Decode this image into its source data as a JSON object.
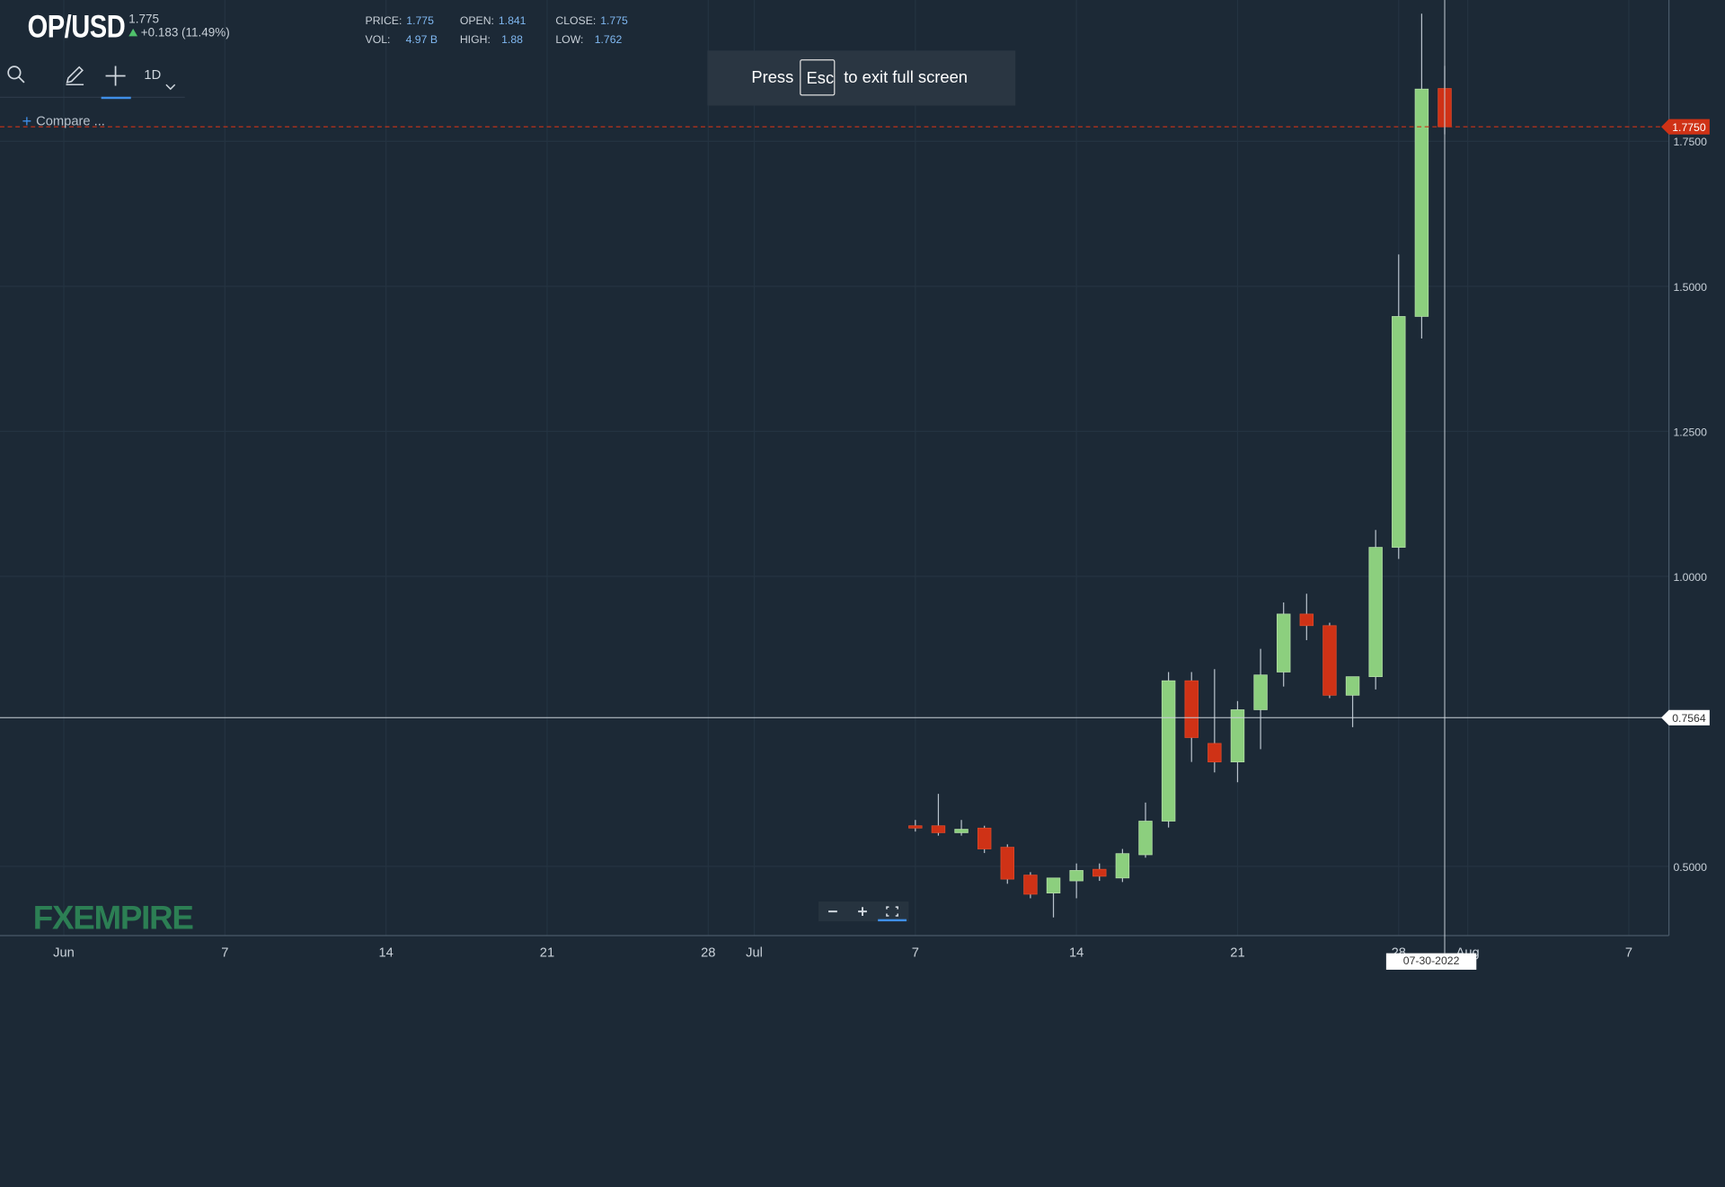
{
  "header": {
    "symbol": "OP/USD",
    "last_price": "1.775",
    "change": "+0.183 (11.49%)",
    "stats": {
      "price_label": "PRICE:",
      "price": "1.775",
      "open_label": "OPEN:",
      "open": "1.841",
      "close_label": "CLOSE:",
      "close": "1.775",
      "vol_label": "VOL:",
      "vol": "4.97 B",
      "high_label": "HIGH:",
      "high": "1.88",
      "low_label": "LOW:",
      "low": "1.762"
    }
  },
  "toolbar": {
    "interval": "1D",
    "compare_label": "Compare ..."
  },
  "fullscreen_notice": {
    "press": "Press",
    "key": "Esc",
    "rest": "to exit full screen"
  },
  "crosshair": {
    "date": "07-30-2022",
    "price": "0.7564"
  },
  "logo": "FXEMPIRE",
  "colors": {
    "background": "#1c2936",
    "up": "#8ccf7e",
    "down": "#cf3216",
    "last_price_line": "#cf3216"
  },
  "chart_data": {
    "type": "candlestick",
    "x_tick_labels": [
      "Jun",
      "7",
      "14",
      "21",
      "28",
      "Jul",
      "7",
      "14",
      "21",
      "28",
      "Aug",
      "7"
    ],
    "y_tick_labels": [
      "0.5000",
      "1.0000",
      "1.2500",
      "1.5000",
      "1.7500"
    ],
    "last_price_label": "1.7750",
    "ylim": [
      0.38,
      1.99
    ],
    "grid": true,
    "candles": [
      {
        "date": "07-07-2022",
        "open": 0.57,
        "high": 0.58,
        "low": 0.56,
        "close": 0.566
      },
      {
        "date": "07-08-2022",
        "open": 0.57,
        "high": 0.625,
        "low": 0.553,
        "close": 0.558
      },
      {
        "date": "07-09-2022",
        "open": 0.558,
        "high": 0.58,
        "low": 0.553,
        "close": 0.564
      },
      {
        "date": "07-10-2022",
        "open": 0.566,
        "high": 0.57,
        "low": 0.523,
        "close": 0.53
      },
      {
        "date": "07-11-2022",
        "open": 0.533,
        "high": 0.538,
        "low": 0.47,
        "close": 0.478
      },
      {
        "date": "07-12-2022",
        "open": 0.485,
        "high": 0.49,
        "low": 0.445,
        "close": 0.452
      },
      {
        "date": "07-13-2022",
        "open": 0.454,
        "high": 0.478,
        "low": 0.412,
        "close": 0.48
      },
      {
        "date": "07-14-2022",
        "open": 0.475,
        "high": 0.505,
        "low": 0.445,
        "close": 0.493
      },
      {
        "date": "07-15-2022",
        "open": 0.495,
        "high": 0.505,
        "low": 0.475,
        "close": 0.483
      },
      {
        "date": "07-16-2022",
        "open": 0.48,
        "high": 0.53,
        "low": 0.473,
        "close": 0.522
      },
      {
        "date": "07-17-2022",
        "open": 0.52,
        "high": 0.61,
        "low": 0.515,
        "close": 0.578
      },
      {
        "date": "07-18-2022",
        "open": 0.578,
        "high": 0.835,
        "low": 0.567,
        "close": 0.82
      },
      {
        "date": "07-19-2022",
        "open": 0.82,
        "high": 0.835,
        "low": 0.68,
        "close": 0.722
      },
      {
        "date": "07-20-2022",
        "open": 0.712,
        "high": 0.84,
        "low": 0.662,
        "close": 0.68
      },
      {
        "date": "07-21-2022",
        "open": 0.68,
        "high": 0.785,
        "low": 0.645,
        "close": 0.77
      },
      {
        "date": "07-22-2022",
        "open": 0.77,
        "high": 0.875,
        "low": 0.702,
        "close": 0.83
      },
      {
        "date": "07-23-2022",
        "open": 0.835,
        "high": 0.955,
        "low": 0.81,
        "close": 0.935
      },
      {
        "date": "07-24-2022",
        "open": 0.935,
        "high": 0.97,
        "low": 0.89,
        "close": 0.915
      },
      {
        "date": "07-25-2022",
        "open": 0.915,
        "high": 0.92,
        "low": 0.79,
        "close": 0.795
      },
      {
        "date": "07-26-2022",
        "open": 0.795,
        "high": 0.825,
        "low": 0.74,
        "close": 0.827
      },
      {
        "date": "07-27-2022",
        "open": 0.827,
        "high": 1.08,
        "low": 0.805,
        "close": 1.05
      },
      {
        "date": "07-28-2022",
        "open": 1.05,
        "high": 1.555,
        "low": 1.03,
        "close": 1.448
      },
      {
        "date": "07-29-2022",
        "open": 1.448,
        "high": 1.97,
        "low": 1.41,
        "close": 1.84
      },
      {
        "date": "07-30-2022",
        "open": 1.841,
        "high": 1.88,
        "low": 1.762,
        "close": 1.775
      }
    ]
  }
}
